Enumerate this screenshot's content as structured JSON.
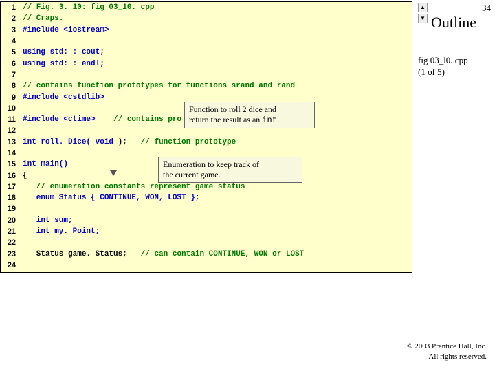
{
  "slide_number": "34",
  "outline": {
    "heading": "Outline",
    "file": "fig 03_l0. cpp",
    "part": "(1 of 5)"
  },
  "nav": {
    "up": "▲",
    "down": "▼"
  },
  "code": [
    {
      "n": "1",
      "cls": "c-green",
      "t": "// Fig. 3. 10: fig 03_10. cpp"
    },
    {
      "n": "2",
      "cls": "c-green",
      "t": "// Craps."
    },
    {
      "n": "3",
      "cls": "c-blue",
      "t": "#include <iostream>"
    },
    {
      "n": "4",
      "cls": "",
      "t": ""
    },
    {
      "n": "5",
      "cls": "c-blue",
      "t": "using std: : cout;"
    },
    {
      "n": "6",
      "cls": "c-blue",
      "t": "using std: : endl;"
    },
    {
      "n": "7",
      "cls": "",
      "t": ""
    },
    {
      "n": "8",
      "cls": "c-green",
      "t": "// contains function prototypes for functions srand and rand"
    },
    {
      "n": "9",
      "cls": "c-blue",
      "t": "#include <cstdlib>"
    },
    {
      "n": "10",
      "cls": "",
      "t": ""
    },
    {
      "n": "11",
      "cls": "",
      "t": ""
    },
    {
      "n": "12",
      "cls": "",
      "t": ""
    },
    {
      "n": "13",
      "cls": "",
      "t": ""
    },
    {
      "n": "14",
      "cls": "",
      "t": ""
    },
    {
      "n": "15",
      "cls": "c-blue",
      "t": "int main()"
    },
    {
      "n": "16",
      "cls": "c-black",
      "t": "{"
    },
    {
      "n": "17",
      "cls": "c-green",
      "t": "   // enumeration constants represent game status"
    },
    {
      "n": "18",
      "cls": "c-blue",
      "t": "   enum Status { CONTINUE, WON, LOST };"
    },
    {
      "n": "19",
      "cls": "",
      "t": ""
    },
    {
      "n": "20",
      "cls": "c-blue",
      "t": "   int sum;"
    },
    {
      "n": "21",
      "cls": "c-blue",
      "t": "   int my. Point;"
    },
    {
      "n": "22",
      "cls": "",
      "t": ""
    },
    {
      "n": "23",
      "cls": "",
      "t": ""
    },
    {
      "n": "24",
      "cls": "",
      "t": ""
    }
  ],
  "row11a": {
    "pre": "#include <ctime>    ",
    "com": "// contains pro"
  },
  "row11b": {
    "t_blue": "return the result as an ",
    "t_mono": "int",
    "t_end": "."
  },
  "row13": {
    "a": "int roll. Dice( ",
    "b": "void",
    "c": " );   ",
    "d": "// function prototype"
  },
  "row23": {
    "a": "   Status game. Status;   ",
    "b": "// can contain CONTINUE, WON or LOST"
  },
  "callouts": {
    "c1_line1": "Function to roll 2 dice and",
    "c2_line1": "Enumeration to keep track of",
    "c2_line2": "the current game."
  },
  "copyright": {
    "line1": "© 2003 Prentice Hall, Inc.",
    "line2": "All rights reserved."
  }
}
